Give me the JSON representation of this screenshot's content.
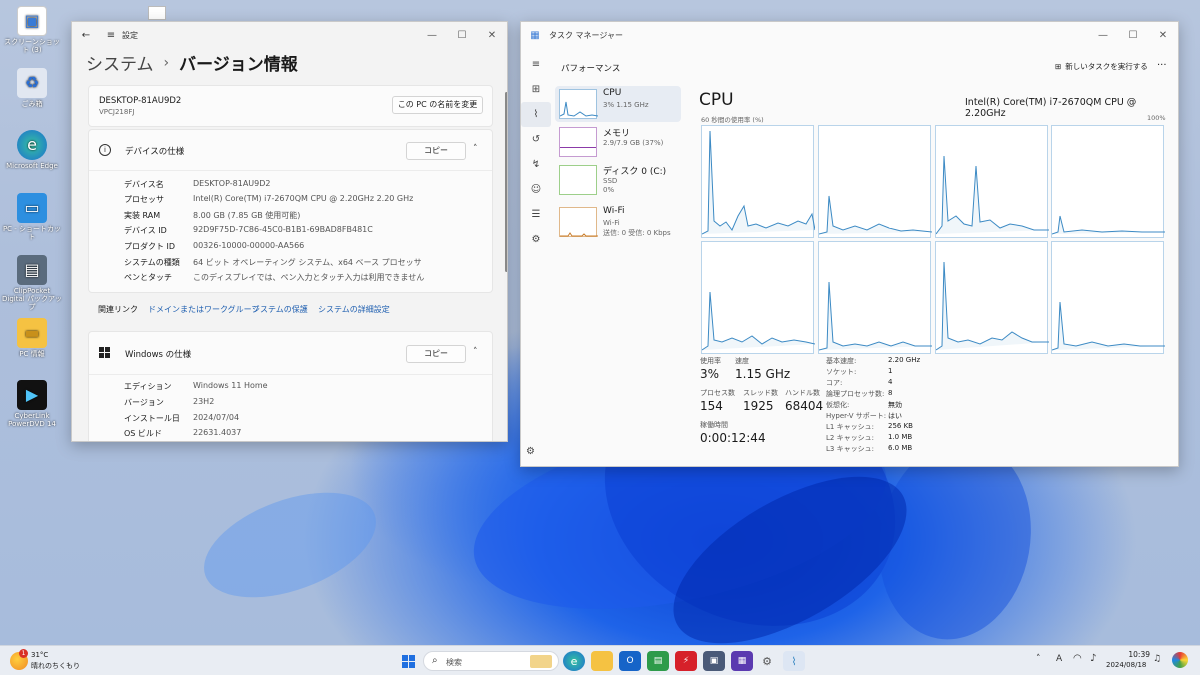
{
  "desktop": {
    "icons": [
      {
        "label": "スクリーンショット (3)",
        "icon": "image-icon"
      },
      {
        "label": "ごみ箱",
        "icon": "recycle-bin-icon"
      },
      {
        "label": "Microsoft Edge",
        "icon": "edge-icon"
      },
      {
        "label": "PC - ショートカット",
        "icon": "pc-icon"
      },
      {
        "label": "ClipPocket Digital パックアップ",
        "icon": "clippocket-icon"
      },
      {
        "label": "PC 情報",
        "icon": "folder-icon"
      },
      {
        "label": "CyberLink PowerDVD 14",
        "icon": "powerdvd-icon"
      }
    ]
  },
  "settings": {
    "app_title": "設定",
    "breadcrumb_parent": "システム",
    "breadcrumb_sep": "›",
    "page_title": "バージョン情報",
    "device_name": "DESKTOP-81AU9D2",
    "device_model": "VPCJ218FJ",
    "rename_button": "この PC の名前を変更",
    "device_spec": {
      "header": "デバイスの仕様",
      "copy_button": "コピー",
      "rows": [
        {
          "key": "デバイス名",
          "value": "DESKTOP-81AU9D2"
        },
        {
          "key": "プロセッサ",
          "value": "Intel(R) Core(TM) i7-2670QM CPU @ 2.20GHz   2.20 GHz"
        },
        {
          "key": "実装 RAM",
          "value": "8.00 GB (7.85 GB 使用可能)"
        },
        {
          "key": "デバイス ID",
          "value": "92D9F75D-7C86-45C0-B1B1-69BAD8FB481C"
        },
        {
          "key": "プロダクト ID",
          "value": "00326-10000-00000-AA566"
        },
        {
          "key": "システムの種類",
          "value": "64 ビット オペレーティング システム、x64 ベース プロセッサ"
        },
        {
          "key": "ペンとタッチ",
          "value": "このディスプレイでは、ペン入力とタッチ入力は利用できません"
        }
      ]
    },
    "related_links": {
      "label": "関連リンク",
      "links": [
        "ドメインまたはワークグループ",
        "システムの保護",
        "システムの詳細設定"
      ]
    },
    "windows_spec": {
      "header": "Windows の仕様",
      "copy_button": "コピー",
      "rows": [
        {
          "key": "エディション",
          "value": "Windows 11 Home"
        },
        {
          "key": "バージョン",
          "value": "23H2"
        },
        {
          "key": "インストール日",
          "value": "2024/07/04"
        },
        {
          "key": "OS ビルド",
          "value": "22631.4037"
        }
      ]
    }
  },
  "taskmanager": {
    "app_title": "タスク マネージャー",
    "section": "パフォーマンス",
    "new_task_button": "新しいタスクを実行する",
    "more": "···",
    "items": [
      {
        "name": "CPU",
        "sub1": "3%  1.15 GHz",
        "sub2": ""
      },
      {
        "name": "メモリ",
        "sub1": "2.9/7.9 GB (37%)",
        "sub2": ""
      },
      {
        "name": "ディスク 0 (C:)",
        "sub1": "SSD",
        "sub2": "0%"
      },
      {
        "name": "Wi-Fi",
        "sub1": "Wi-Fi",
        "sub2": "送信: 0 受信: 0 Kbps"
      }
    ],
    "cpu_title": "CPU",
    "cpu_model": "Intel(R) Core(TM) i7-2670QM CPU @ 2.20GHz",
    "graph_caption": "60 秒間の使用率 (%)",
    "graph_max": "100%",
    "stats": {
      "usage_label": "使用率",
      "usage": "3%",
      "speed_label": "速度",
      "speed": "1.15 GHz",
      "proc_label": "プロセス数",
      "proc": "154",
      "threads_label": "スレッド数",
      "threads": "1925",
      "handles_label": "ハンドル数",
      "handles": "68404",
      "uptime_label": "稼働時間",
      "uptime": "0:00:12:44"
    },
    "specs": [
      {
        "k": "基本速度:",
        "v": "2.20 GHz"
      },
      {
        "k": "ソケット:",
        "v": "1"
      },
      {
        "k": "コア:",
        "v": "4"
      },
      {
        "k": "論理プロセッサ数:",
        "v": "8"
      },
      {
        "k": "仮想化:",
        "v": "無効"
      },
      {
        "k": "Hyper-V サポート:",
        "v": "はい"
      },
      {
        "k": "L1 キャッシュ:",
        "v": "256 KB"
      },
      {
        "k": "L2 キャッシュ:",
        "v": "1.0 MB"
      },
      {
        "k": "L3 キャッシュ:",
        "v": "6.0 MB"
      }
    ]
  },
  "taskbar": {
    "weather_temp": "31°C",
    "weather_desc": "晴れのちくもり",
    "weather_badge": "1",
    "search_placeholder": "検索",
    "time": "10:39",
    "date": "2024/08/18",
    "ime": "A"
  }
}
